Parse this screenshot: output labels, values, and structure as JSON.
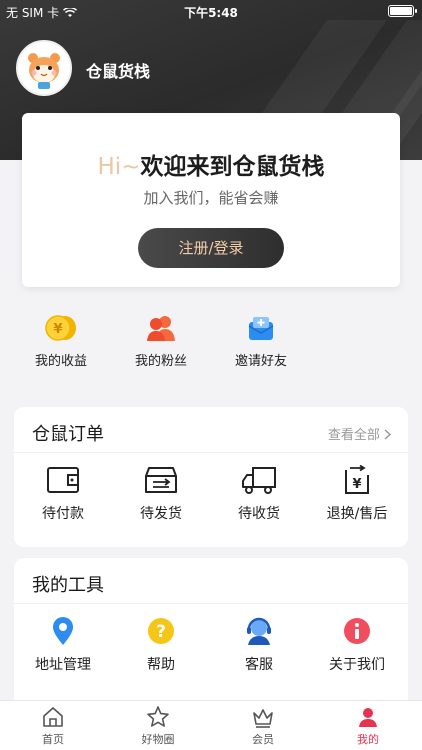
{
  "status_bar": {
    "carrier": "无 SIM 卡",
    "time": "下午5:48"
  },
  "profile": {
    "shop_name": "仓鼠货栈"
  },
  "welcome": {
    "hi": "Hi~",
    "title": "欢迎来到仓鼠货栈",
    "subtitle": "加入我们，能省会赚",
    "button": "注册/登录"
  },
  "quick_actions": [
    {
      "label": "我的收益",
      "icon": "coin-icon"
    },
    {
      "label": "我的粉丝",
      "icon": "fans-icon"
    },
    {
      "label": "邀请好友",
      "icon": "invite-icon"
    }
  ],
  "orders": {
    "title": "仓鼠订单",
    "more": "查看全部",
    "items": [
      {
        "label": "待付款",
        "icon": "wallet-icon"
      },
      {
        "label": "待发货",
        "icon": "box-icon"
      },
      {
        "label": "待收货",
        "icon": "truck-icon"
      },
      {
        "label": "退换/售后",
        "icon": "refund-icon"
      }
    ]
  },
  "tools": {
    "title": "我的工具",
    "items": [
      {
        "label": "地址管理",
        "icon": "location-icon"
      },
      {
        "label": "帮助",
        "icon": "help-icon"
      },
      {
        "label": "客服",
        "icon": "customer-service-icon"
      },
      {
        "label": "关于我们",
        "icon": "info-icon"
      }
    ]
  },
  "tabbar": {
    "items": [
      {
        "label": "首页",
        "icon": "home-icon"
      },
      {
        "label": "好物圈",
        "icon": "star-icon"
      },
      {
        "label": "会员",
        "icon": "crown-icon"
      },
      {
        "label": "我的",
        "icon": "user-icon"
      }
    ],
    "active_index": 3
  },
  "colors": {
    "accent": "#e6334f",
    "gold": "#f3cda8",
    "dark": "#2e2e2e"
  }
}
